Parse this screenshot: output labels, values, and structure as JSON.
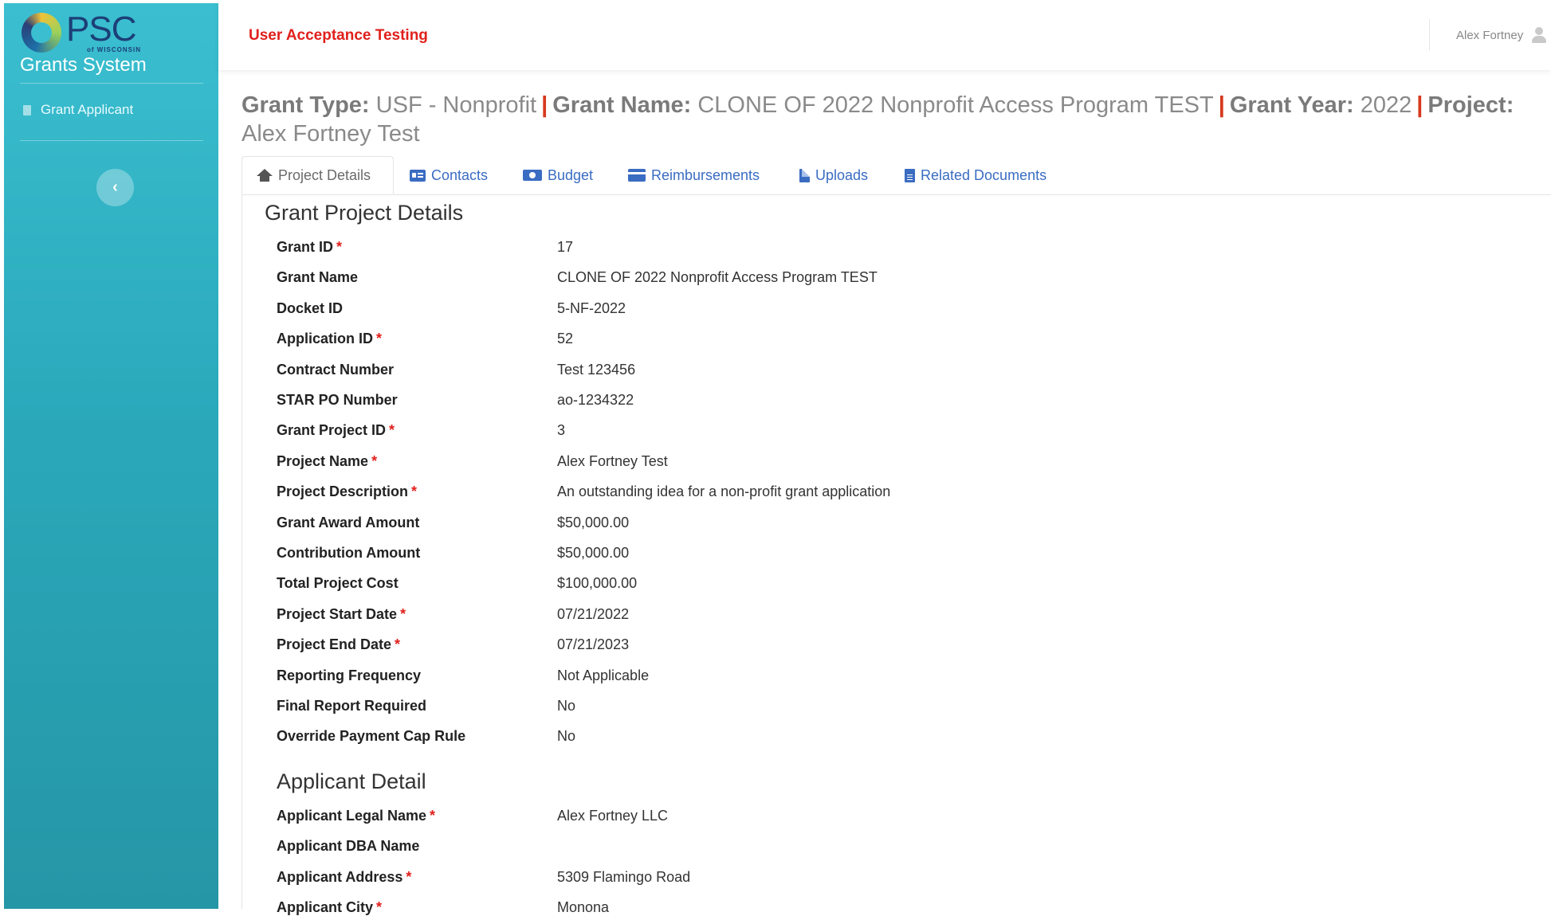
{
  "sidebar": {
    "logo_text": "PSC",
    "logo_subtext": "of WISCONSIN",
    "app_name": "Grants System",
    "items": [
      {
        "label": "Grant Applicant"
      }
    ],
    "collapse_glyph": "‹"
  },
  "topbar": {
    "environment": "User Acceptance Testing",
    "user_name": "Alex Fortney"
  },
  "headline": {
    "grant_type_label": "Grant Type:",
    "grant_type_value": "USF - Nonprofit",
    "grant_name_label": "Grant Name:",
    "grant_name_value": "CLONE OF 2022 Nonprofit Access Program TEST",
    "grant_year_label": "Grant Year:",
    "grant_year_value": "2022",
    "project_label": "Project:",
    "project_value": "Alex Fortney Test",
    "separator": "|"
  },
  "tabs": [
    {
      "label": "Project Details",
      "icon": "home-icon",
      "active": true
    },
    {
      "label": "Contacts",
      "icon": "address-card-icon"
    },
    {
      "label": "Budget",
      "icon": "money-icon"
    },
    {
      "label": "Reimbursements",
      "icon": "credit-card-icon"
    },
    {
      "label": "Uploads",
      "icon": "file-icon"
    },
    {
      "label": "Related Documents",
      "icon": "file-text-icon"
    }
  ],
  "project_section": {
    "title": "Grant Project Details",
    "fields": [
      {
        "label": "Grant ID",
        "required": true,
        "value": "17"
      },
      {
        "label": "Grant Name",
        "required": false,
        "value": "CLONE OF 2022 Nonprofit Access Program TEST"
      },
      {
        "label": "Docket ID",
        "required": false,
        "value": "5-NF-2022"
      },
      {
        "label": "Application ID",
        "required": true,
        "value": "52"
      },
      {
        "label": "Contract Number",
        "required": false,
        "value": "Test 123456"
      },
      {
        "label": "STAR PO Number",
        "required": false,
        "value": "ao-1234322"
      },
      {
        "label": "Grant Project ID",
        "required": true,
        "value": "3"
      },
      {
        "label": "Project Name",
        "required": true,
        "value": "Alex Fortney Test"
      },
      {
        "label": "Project Description",
        "required": true,
        "value": "An outstanding idea for a non-profit grant application"
      },
      {
        "label": "Grant Award Amount",
        "required": false,
        "value": "$50,000.00"
      },
      {
        "label": "Contribution Amount",
        "required": false,
        "value": "$50,000.00"
      },
      {
        "label": "Total Project Cost",
        "required": false,
        "value": "$100,000.00"
      },
      {
        "label": "Project Start Date",
        "required": true,
        "value": "07/21/2022"
      },
      {
        "label": "Project End Date",
        "required": true,
        "value": "07/21/2023"
      },
      {
        "label": "Reporting Frequency",
        "required": false,
        "value": "Not Applicable"
      },
      {
        "label": "Final Report Required",
        "required": false,
        "value": "No"
      },
      {
        "label": "Override Payment Cap Rule",
        "required": false,
        "value": "No"
      }
    ]
  },
  "applicant_section": {
    "title": "Applicant Detail",
    "fields": [
      {
        "label": "Applicant Legal Name",
        "required": true,
        "value": "Alex Fortney LLC"
      },
      {
        "label": "Applicant DBA Name",
        "required": false,
        "value": ""
      },
      {
        "label": "Applicant Address",
        "required": true,
        "value": "5309 Flamingo Road"
      },
      {
        "label": "Applicant City",
        "required": true,
        "value": "Monona"
      }
    ]
  },
  "required_marker": "*",
  "colors": {
    "sidebar": "#2aa9bb",
    "accent_red": "#e0201c",
    "link_blue": "#3a6cc2"
  }
}
